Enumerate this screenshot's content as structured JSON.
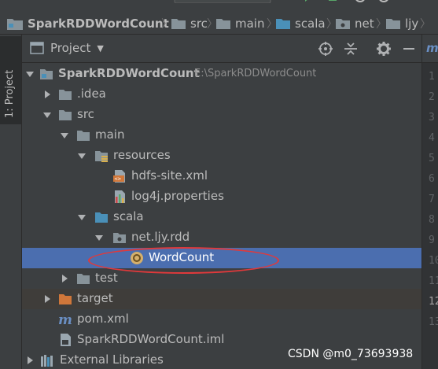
{
  "colors": {
    "selection": "#4b6eaf",
    "highlight_ring": "#e0393b",
    "folder": "#87939a",
    "source_folder": "#4a90b8",
    "excluded_folder": "#d0773a"
  },
  "breadcrumb": {
    "items": [
      {
        "label": "SparkRDDWordCount",
        "icon": "module-icon"
      },
      {
        "label": "src",
        "icon": "folder-icon"
      },
      {
        "label": "main",
        "icon": "folder-icon"
      },
      {
        "label": "scala",
        "icon": "source-folder-icon"
      },
      {
        "label": "net",
        "icon": "package-icon"
      },
      {
        "label": "ljy",
        "icon": "folder-icon"
      }
    ],
    "separator": "〉"
  },
  "left_stripe": {
    "tab_label": "1: Project"
  },
  "project_panel": {
    "title": "Project",
    "toolbar_icons": [
      "locate-icon",
      "collapse-all-icon",
      "settings-gear-icon",
      "hide-minimize-icon"
    ]
  },
  "tree": [
    {
      "label": "SparkRDDWordCount",
      "path": "E:\\SparkRDDWordCount",
      "icon": "module-folder-icon",
      "expanded": true
    },
    {
      "label": ".idea",
      "icon": "folder-icon",
      "expanded": false
    },
    {
      "label": "src",
      "icon": "folder-icon",
      "expanded": true
    },
    {
      "label": "main",
      "icon": "folder-icon",
      "expanded": true
    },
    {
      "label": "resources",
      "icon": "resources-folder-icon",
      "expanded": true
    },
    {
      "label": "hdfs-site.xml",
      "icon": "xml-file-icon"
    },
    {
      "label": "log4j.properties",
      "icon": "properties-file-icon"
    },
    {
      "label": "scala",
      "icon": "source-folder-icon",
      "expanded": true
    },
    {
      "label": "net.ljy.rdd",
      "icon": "package-icon",
      "expanded": true
    },
    {
      "label": "WordCount",
      "icon": "scala-object-icon",
      "selected": true
    },
    {
      "label": "test",
      "icon": "folder-icon",
      "expanded": false
    },
    {
      "label": "target",
      "icon": "excluded-folder-icon",
      "expanded": false
    },
    {
      "label": "pom.xml",
      "icon": "maven-icon"
    },
    {
      "label": "SparkRDDWordCount.iml",
      "icon": "iml-file-icon"
    },
    {
      "label": "External Libraries",
      "icon": "libraries-icon",
      "expanded": false
    }
  ],
  "editor": {
    "tab_glyph": "m",
    "line_numbers": [
      "1",
      "2",
      "3",
      "4",
      "5",
      "6",
      "7",
      "8",
      "9",
      "10",
      "11",
      "12",
      "13"
    ]
  },
  "watermark": "CSDN @m0_73693938"
}
